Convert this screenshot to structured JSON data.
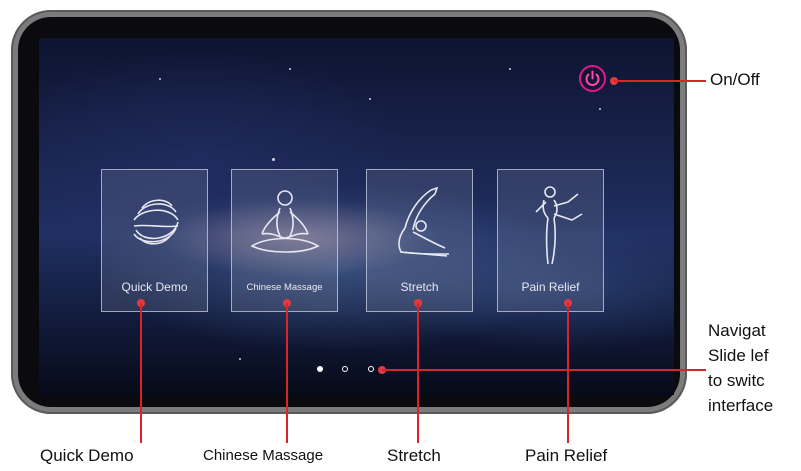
{
  "screen": {
    "cards": [
      {
        "label": "Quick Demo",
        "icon": "hands-icon"
      },
      {
        "label": "Chinese Massage",
        "icon": "meditation-icon"
      },
      {
        "label": "Stretch",
        "icon": "yoga-pose-icon"
      },
      {
        "label": "Pain Relief",
        "icon": "kick-pose-icon"
      }
    ],
    "page_indicator": {
      "total": 3,
      "active": 1
    },
    "power_icon": "power-icon"
  },
  "annotations": {
    "on_off": "On/Off",
    "quick_demo": "Quick Demo",
    "chinese_massage": "Chinese Massage",
    "stretch": "Stretch",
    "pain_relief": "Pain Relief",
    "navigation_lines": [
      "Navigat",
      "Slide lef",
      "to switc",
      "interface"
    ]
  },
  "colors": {
    "callout_red": "#d9252a",
    "power_magenta": "#e0188c",
    "device_frame": "#7c7c7c"
  }
}
